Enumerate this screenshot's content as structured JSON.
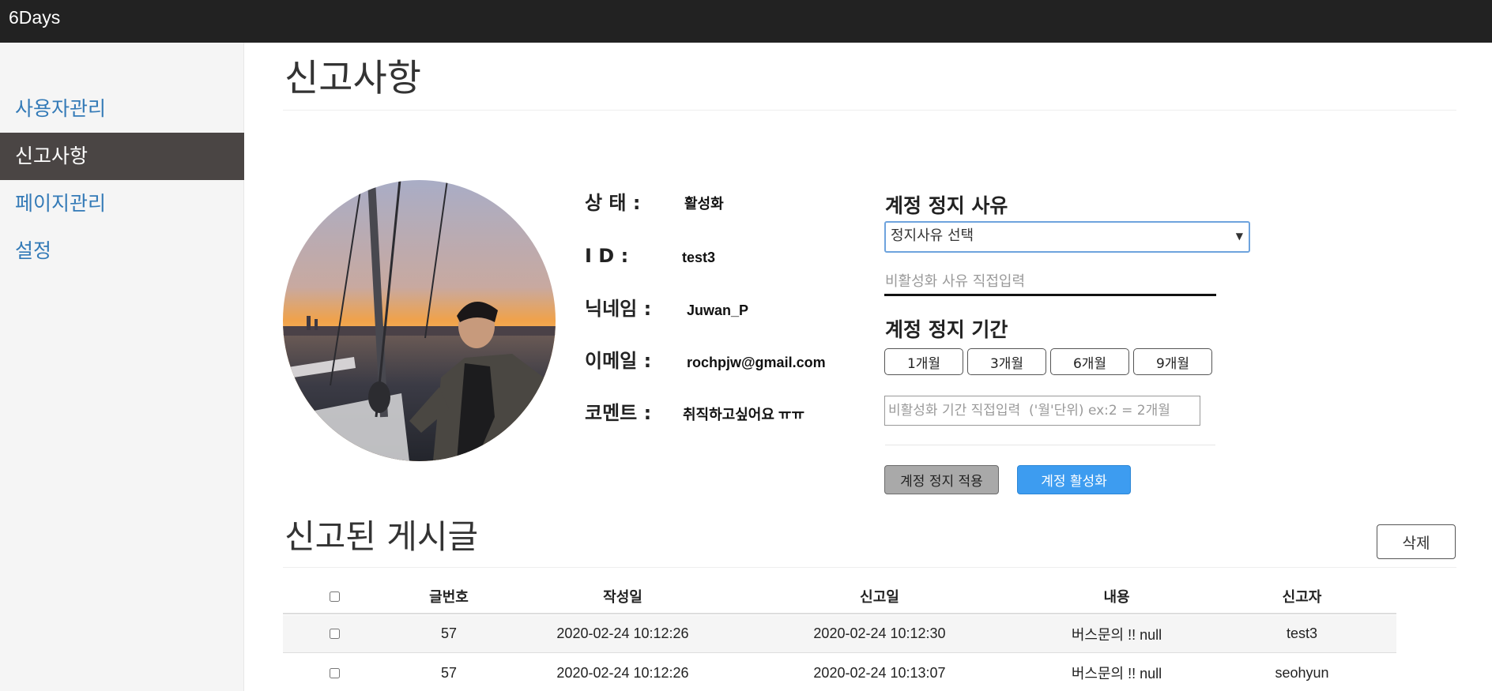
{
  "app": {
    "brand": "6Days"
  },
  "sidebar": {
    "items": [
      {
        "label": "사용자관리",
        "active": false
      },
      {
        "label": "신고사항",
        "active": true
      },
      {
        "label": "페이지관리",
        "active": false
      },
      {
        "label": "설정",
        "active": false
      }
    ]
  },
  "page": {
    "title": "신고사항"
  },
  "profile": {
    "avatar_alt": "profile photo",
    "fields": [
      {
        "label": "상 태 :",
        "value": "활성화"
      },
      {
        "label": "I D :",
        "value": "test3"
      },
      {
        "label": "닉네임 :",
        "value": "Juwan_P"
      },
      {
        "label": "이메일 :",
        "value": "rochpjw@gmail.com"
      },
      {
        "label": "코멘트 :",
        "value": "취직하고싶어요 ㅠㅠ"
      }
    ]
  },
  "suspension": {
    "reason_heading": "계정 정지 사유",
    "reason_select_value": "정지사유 선택",
    "reason_input_placeholder": "비활성화 사유 직접입력",
    "period_heading": "계정 정지 기간",
    "period_buttons": [
      "1개월",
      "3개월",
      "6개월",
      "9개월"
    ],
    "period_input_placeholder": "비활성화 기간 직접입력  ('월'단위) ex:2 = 2개월",
    "apply_button": "계정 정지 적용",
    "activate_button": "계정 활성화",
    "colors": {
      "apply_bg": "#a9a9a9",
      "activate_bg": "#3d9cf0"
    }
  },
  "reported_posts": {
    "title": "신고된 게시글",
    "delete_button": "삭제",
    "columns": [
      "",
      "글번호",
      "작성일",
      "신고일",
      "내용",
      "신고자"
    ],
    "rows": [
      {
        "post_no": "57",
        "created": "2020-02-24 10:12:26",
        "reported": "2020-02-24 10:12:30",
        "content": "버스문의 !! null",
        "reporter": "test3"
      },
      {
        "post_no": "57",
        "created": "2020-02-24 10:12:26",
        "reported": "2020-02-24 10:13:07",
        "content": "버스문의 !! null",
        "reporter": "seohyun"
      }
    ]
  }
}
